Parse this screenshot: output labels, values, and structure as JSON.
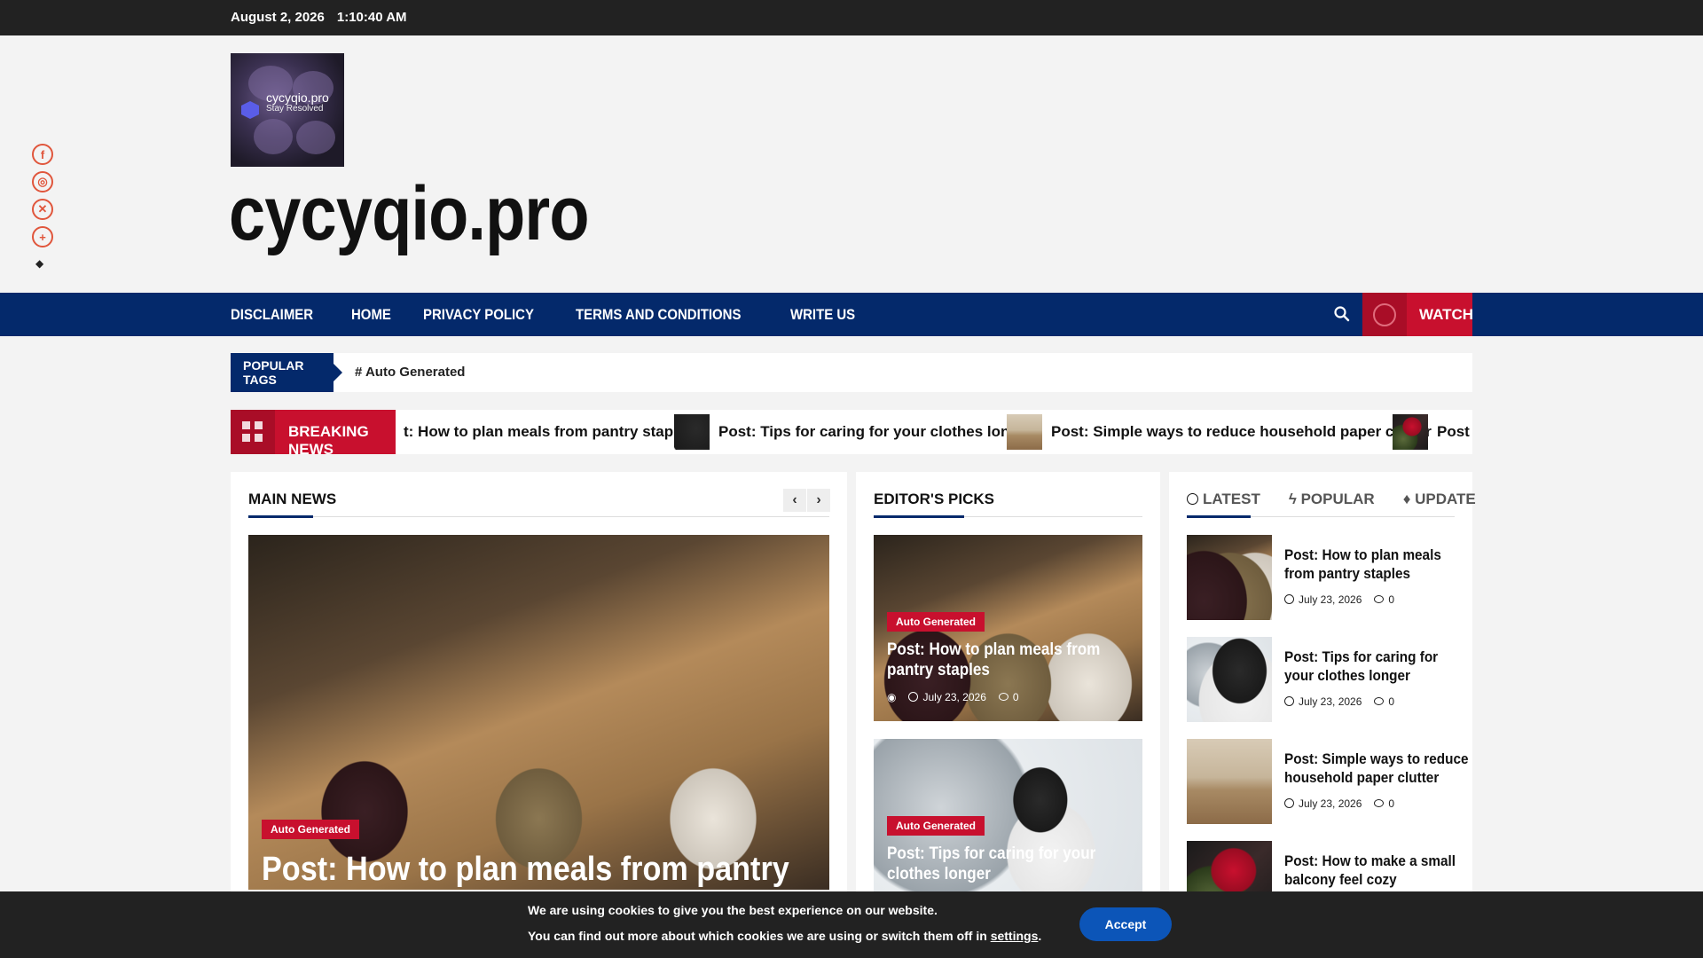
{
  "topbar": {
    "date": "August 2, 2026",
    "time": "1:10:40 AM"
  },
  "header": {
    "logo_text": "cycyqio.pro",
    "logo_tagline": "Stay Resolved",
    "site_title": "cycyqio.pro"
  },
  "social": [
    {
      "name": "facebook-icon",
      "glyph": "f"
    },
    {
      "name": "instagram-icon",
      "glyph": "◎"
    },
    {
      "name": "x-icon",
      "glyph": "✕"
    },
    {
      "name": "more-icon",
      "glyph": "+"
    }
  ],
  "nav": {
    "items": [
      "DISCLAIMER",
      "HOME",
      "PRIVACY POLICY",
      "TERMS AND CONDITIONS",
      "WRITE US"
    ],
    "watch_label": "WATCH"
  },
  "popular_tags": {
    "label": "POPULAR TAGS",
    "tag": "# Auto Generated"
  },
  "breaking": {
    "label": "BREAKING NEWS",
    "items": [
      "t: How to plan meals from pantry staples",
      "Post: Tips for caring for your clothes longer",
      "Post: Simple ways to reduce household paper clutter",
      "Post"
    ]
  },
  "main_news": {
    "title": "MAIN NEWS",
    "category": "Auto Generated",
    "headline": "Post: How to plan meals from pantry staples"
  },
  "editors_picks": {
    "title": "EDITOR'S PICKS",
    "items": [
      {
        "category": "Auto Generated",
        "headline": "Post: How to plan meals from pantry staples",
        "date": "July 23, 2026",
        "comments": "0"
      },
      {
        "category": "Auto Generated",
        "headline": "Post: Tips for caring for your clothes longer"
      }
    ]
  },
  "sidebar": {
    "tabs": [
      "LATEST",
      "POPULAR",
      "UPDATE"
    ],
    "items": [
      {
        "title": "Post: How to plan meals from pantry staples",
        "date": "July 23, 2026",
        "comments": "0"
      },
      {
        "title": "Post: Tips for caring for your clothes longer",
        "date": "July 23, 2026",
        "comments": "0"
      },
      {
        "title": "Post: Simple ways to reduce household paper clutter",
        "date": "July 23, 2026",
        "comments": "0"
      },
      {
        "title": "Post: How to make a small balcony feel cozy"
      }
    ]
  },
  "cookie": {
    "line1": "We are using cookies to give you the best experience on our website.",
    "line2_prefix": "You can find out more about which cookies we are using or switch them off in",
    "line2_link": "settings",
    "line2_suffix": ".",
    "accept": "Accept"
  },
  "colors": {
    "brand_navy": "#04296b",
    "accent_red": "#c8102e",
    "social_orange": "#e0553b"
  }
}
